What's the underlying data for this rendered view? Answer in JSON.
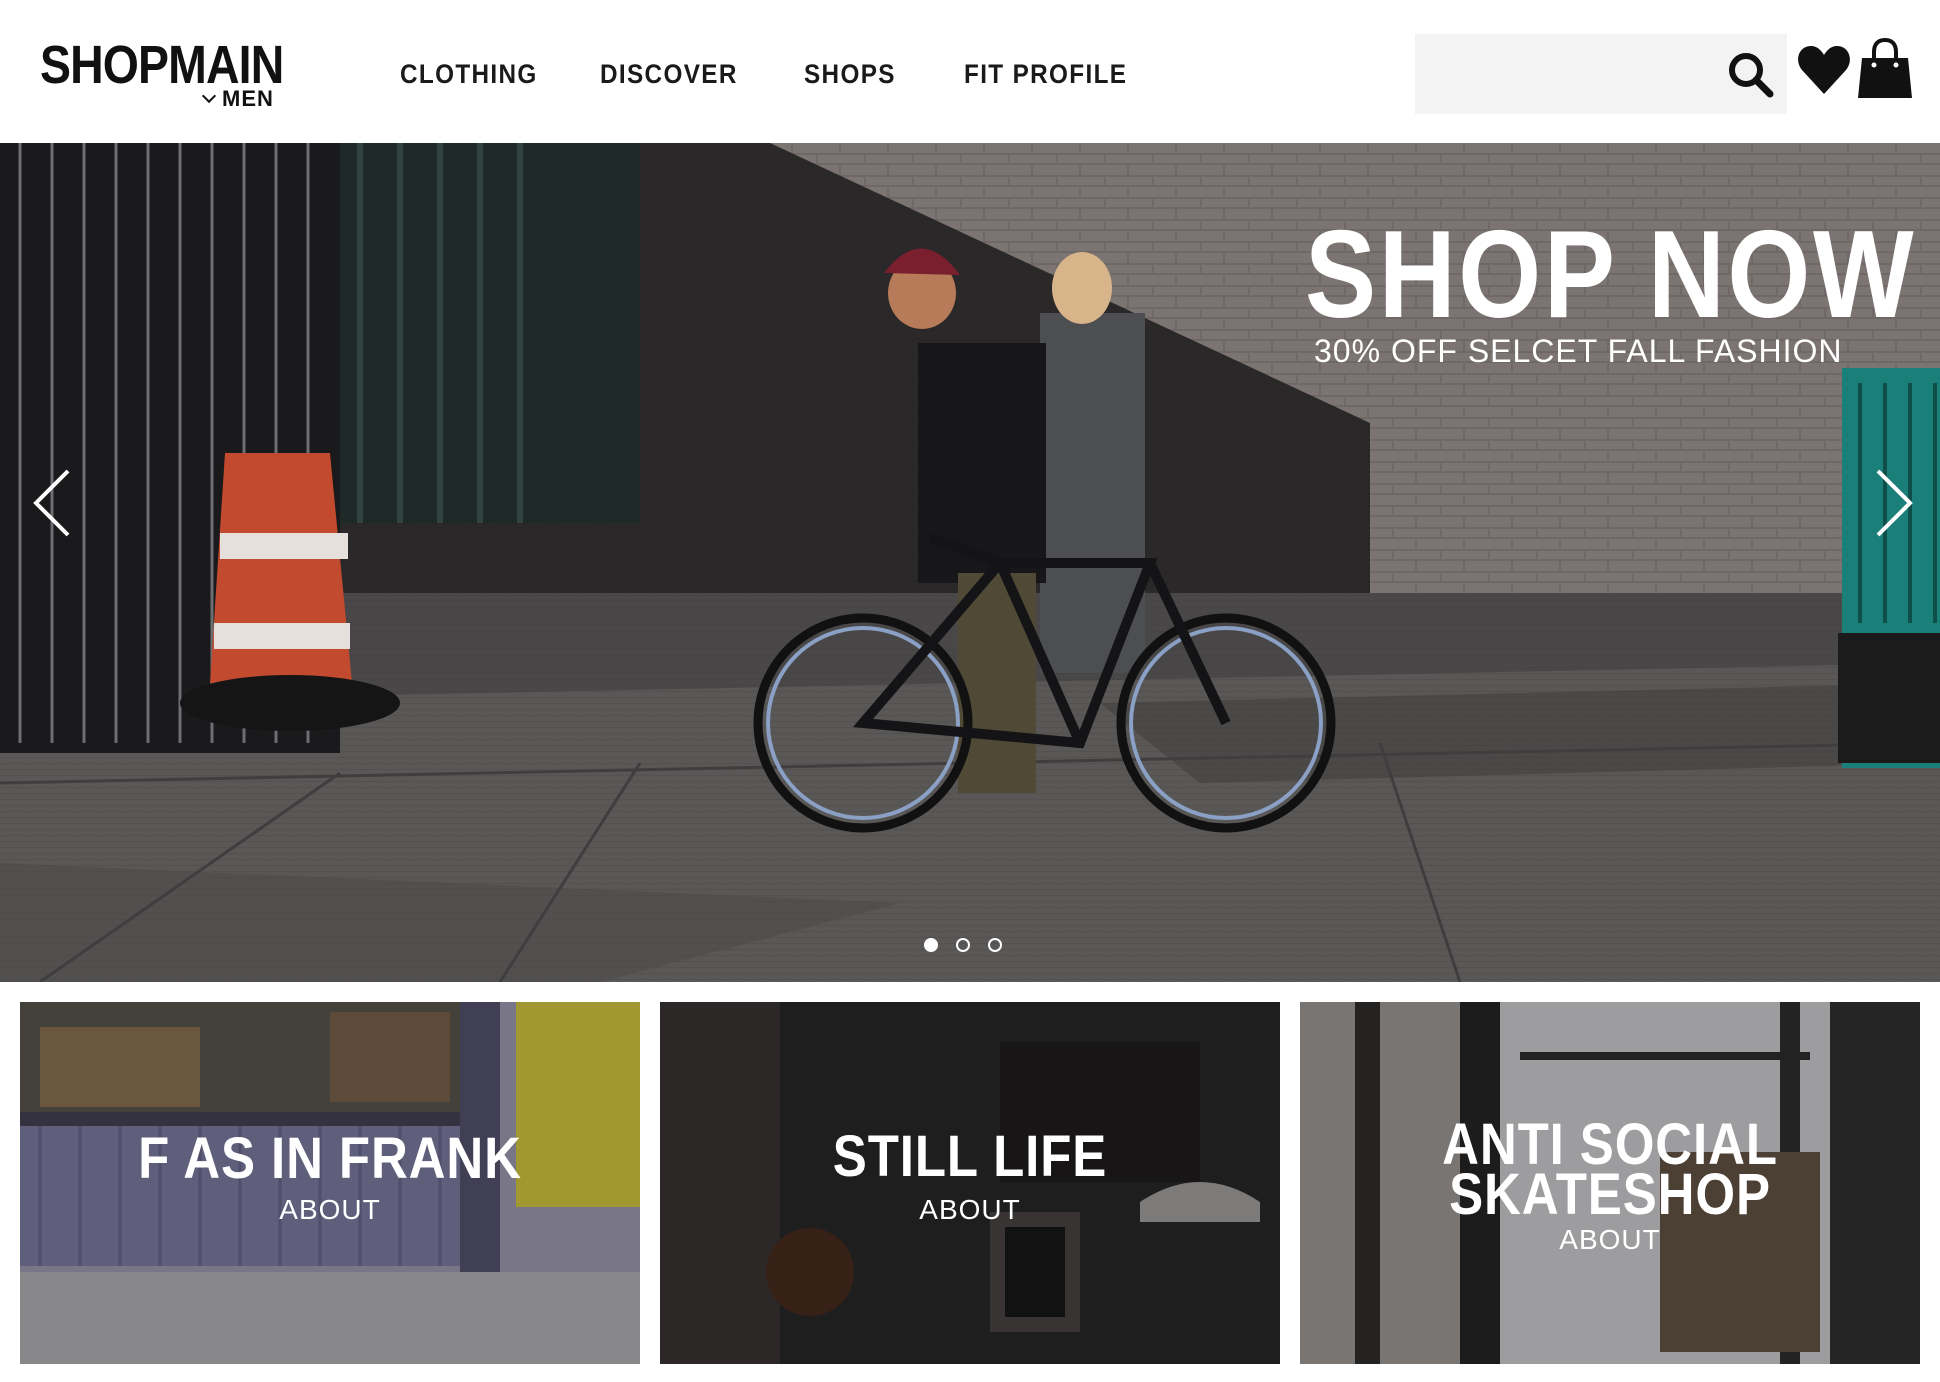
{
  "header": {
    "logo": "SHOPMAIN",
    "section": "MEN",
    "nav": [
      {
        "label": "CLOTHING"
      },
      {
        "label": "DISCOVER"
      },
      {
        "label": "SHOPS"
      },
      {
        "label": "FIT PROFILE"
      }
    ],
    "search": {
      "value": "",
      "placeholder": ""
    },
    "icons": [
      "search-icon",
      "heart-icon",
      "shopping-bag-icon"
    ]
  },
  "hero": {
    "title": "SHOP NOW",
    "subtitle": "30% OFF SELCET FALL FASHION",
    "slides": 3,
    "active_slide": 1
  },
  "shops": [
    {
      "name": "F AS IN FRANK",
      "link": "ABOUT"
    },
    {
      "name": "STILL LIFE",
      "link": "ABOUT"
    },
    {
      "name_line1": "ANTI SOCIAL",
      "name_line2": "SKATESHOP",
      "link": "ABOUT"
    }
  ],
  "colors": {
    "text": "#111111",
    "search_bg": "#f3f3f3",
    "overlay_text": "#ffffff"
  }
}
